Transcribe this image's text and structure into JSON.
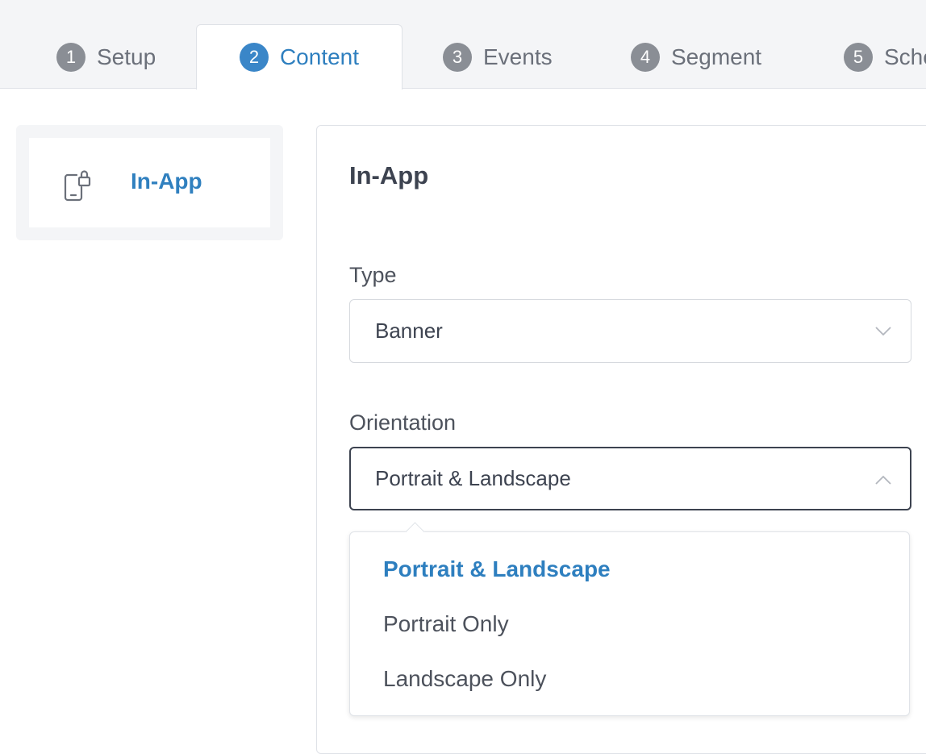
{
  "tabs": [
    {
      "num": "1",
      "label": "Setup"
    },
    {
      "num": "2",
      "label": "Content"
    },
    {
      "num": "3",
      "label": "Events"
    },
    {
      "num": "4",
      "label": "Segment"
    },
    {
      "num": "5",
      "label": "Sche"
    }
  ],
  "active_tab": "Content",
  "sidebar": {
    "items": [
      {
        "label": "In-App",
        "icon": "mobile-lock-icon"
      }
    ]
  },
  "panel": {
    "title": "In-App",
    "type": {
      "label": "Type",
      "value": "Banner"
    },
    "orientation": {
      "label": "Orientation",
      "value": "Portrait & Landscape",
      "options": [
        "Portrait & Landscape",
        "Portrait Only",
        "Landscape Only"
      ],
      "selected_index": 0
    }
  },
  "colors": {
    "accent": "#3a86c8",
    "tab_bar_bg": "#f4f5f7",
    "inactive_badge": "#8a8e95",
    "text": "#3d4350"
  }
}
